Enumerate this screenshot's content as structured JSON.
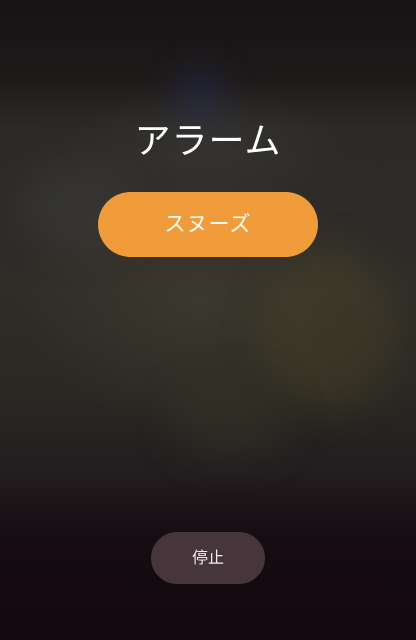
{
  "alarm": {
    "title": "アラーム",
    "snooze_label": "スヌーズ",
    "stop_label": "停止"
  },
  "colors": {
    "snooze_button": "#f19c3a",
    "stop_button": "#46353a",
    "text": "#ffffff"
  }
}
